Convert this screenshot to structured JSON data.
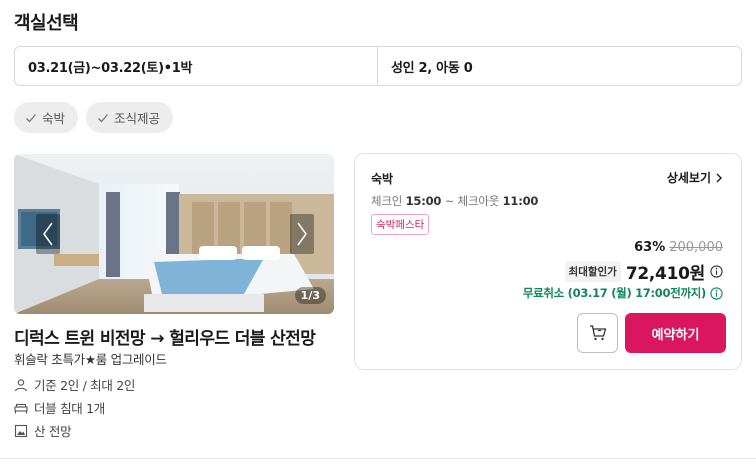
{
  "section": {
    "title": "객실선택"
  },
  "selector": {
    "dates": "03.21(금)~03.22(토)•1박",
    "guests": "성인 2, 아동 0"
  },
  "filters": [
    {
      "label": "숙박",
      "icon": "check-icon"
    },
    {
      "label": "조식제공",
      "icon": "check-icon"
    }
  ],
  "room": {
    "photo_counter": "1/3",
    "name": "디럭스 트윈 비전망 → 헐리우드 더블 산전망",
    "subtitle": "휘슬락 초특가★룸 업그레이드",
    "occupancy": "기준 2인 / 최대 2인",
    "bed": "더블 침대 1개",
    "view": "산 전망"
  },
  "rate": {
    "type": "숙박",
    "details_label": "상세보기",
    "checkin_label": "체크인",
    "checkin_time": "15:00",
    "checkout_label": "체크아웃",
    "checkout_time": "11:00",
    "promo_badge": "숙박페스타",
    "discount_pct": "63%",
    "original_price": "200,000",
    "max_discount_label": "최대할인가",
    "final_price": "72,410원",
    "free_cancel": "무료취소 (03.17 (월) 17:00전까지)",
    "reserve_label": "예약하기"
  },
  "colors": {
    "accent": "#d9165e",
    "cancel_green": "#12865b",
    "chip_bg": "#ededed"
  }
}
